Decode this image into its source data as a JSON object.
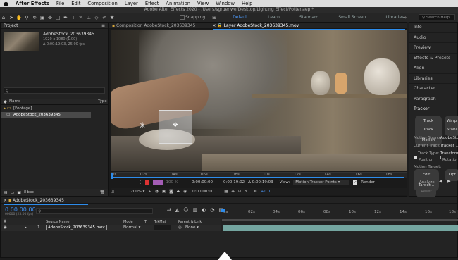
{
  "menubar": {
    "apple": "",
    "app": "After Effects",
    "items": [
      "File",
      "Edit",
      "Composition",
      "Layer",
      "Effect",
      "Animation",
      "View",
      "Window",
      "Help"
    ]
  },
  "titlebar": "Adobe After Effects 2020 - /Users/sgruenwe/Desktop/Lighting Effect/Potter.aep *",
  "toolbar": {
    "snapping": "Snapping",
    "workspaces": [
      {
        "label": "Default",
        "active": true
      },
      {
        "label": "Learn",
        "active": false
      },
      {
        "label": "Standard",
        "active": false
      },
      {
        "label": "Small Screen",
        "active": false
      },
      {
        "label": "Libraries",
        "active": false
      }
    ],
    "search_placeholder": "Search Help"
  },
  "project": {
    "tab": "Project",
    "item_name": "AdobeStock_203639345",
    "item_res": "1920 x 1080 (1.00)",
    "item_dur": "Δ 0:00:19:03, 25.00 fps",
    "search_icon": "magnifier",
    "col_name": "Name",
    "col_type": "Type",
    "rows": [
      {
        "name": "[Footage]",
        "selected": false
      },
      {
        "name": "AdobeStock_203639345",
        "selected": true
      }
    ],
    "bpc": "8 bpc"
  },
  "viewer": {
    "tab_comp": "Composition AdobeStock_203639345",
    "tab_layer": "Layer AdobeStock_203639345.mov",
    "ruler_ticks": [
      "0s",
      "02s",
      "04s",
      "06s",
      "08s",
      "10s",
      "12s",
      "14s",
      "16s",
      "18s"
    ],
    "start_time": "0:00:00:00",
    "end_time": "0:00:19:02",
    "duration": "Δ 0:00:19:03",
    "view_label": "View:",
    "view_value": "Motion Tracker Points",
    "render_label": "Render",
    "zoom": "200%",
    "current_time": "0:00:00:00",
    "exposure": "+0.0",
    "pct": "100 %"
  },
  "right_panels": {
    "items": [
      "Info",
      "Audio",
      "Preview",
      "Effects & Presets",
      "Align",
      "Libraries",
      "Character",
      "Paragraph",
      "Tracker"
    ],
    "tracker": {
      "btn_track_camera": "Track Camera",
      "btn_warp": "Warp S",
      "btn_track_motion": "Track Motion",
      "btn_stabilize": "Stabiliz",
      "motion_source_label": "Motion Source:",
      "motion_source": "AdobeStock",
      "current_track_label": "Current Track:",
      "current_track": "Tracker 1",
      "track_type_label": "Track Type:",
      "track_type": "Transform",
      "position": "Position",
      "rotation": "Rotation",
      "motion_target": "Motion Target:",
      "edit_target": "Edit Target...",
      "opt": "Opt",
      "analyze": "Analyze:",
      "reset": "Reset"
    }
  },
  "timeline": {
    "tab": "AdobeStock_203639345",
    "current_time": "0:00:00:00",
    "fps_sub": "00000 (25.00 fps)",
    "col_source": "Source Name",
    "col_mode": "Mode",
    "col_t": "T",
    "col_trkmat": "TrkMat",
    "col_parent": "Parent & Link",
    "layer_num": "1",
    "layer_name": "AdobeStock_203639345.mov",
    "layer_mode": "Normal",
    "layer_parent": "None",
    "ticks": [
      "0s",
      "02s",
      "04s",
      "06s",
      "08s",
      "10s",
      "12s",
      "14s",
      "16s",
      "18s"
    ]
  },
  "colors": {
    "accent": "#2d8ceb",
    "workspace_active": "#4d9cff",
    "track_bar": "#74a5a0"
  }
}
